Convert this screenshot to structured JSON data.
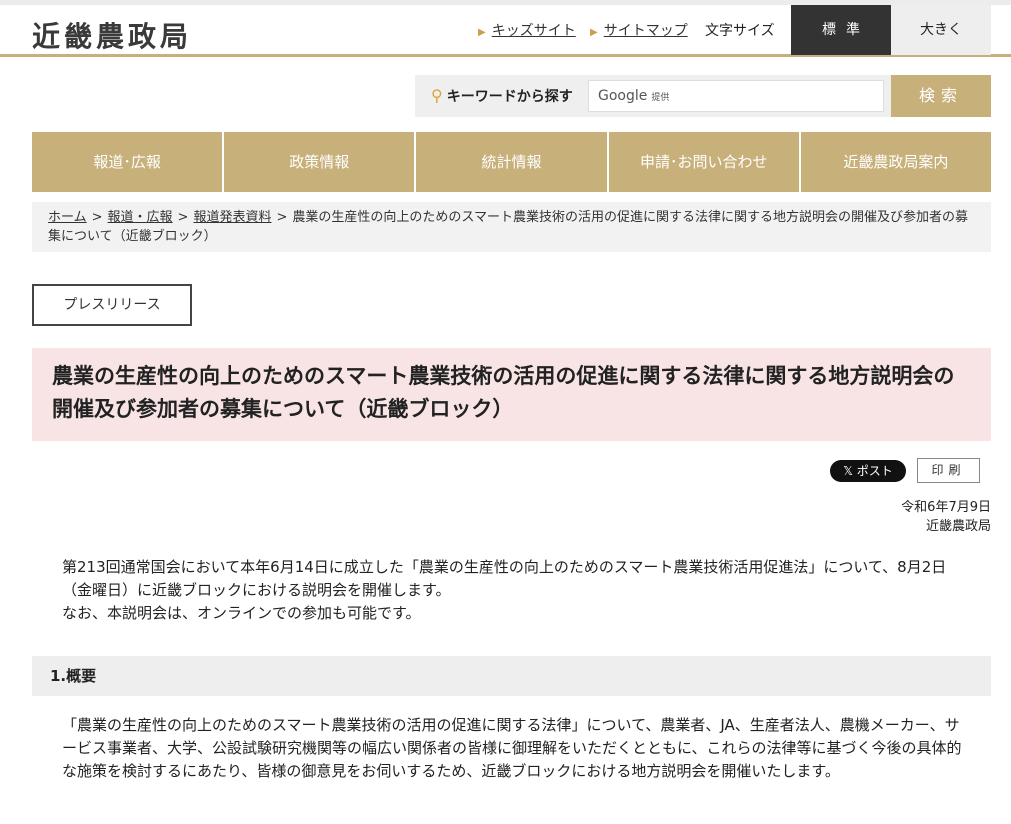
{
  "header": {
    "logo": "近畿農政局",
    "links": [
      "キッズサイト",
      "サイトマップ"
    ],
    "font_size_label": "文字サイズ",
    "font_size_standard": "標準",
    "font_size_large": "大きく"
  },
  "search": {
    "label": "キーワードから探す",
    "placeholder": "Google",
    "provider_suffix": "提供",
    "button": "検索"
  },
  "global_nav": [
    "報道･広報",
    "政策情報",
    "統計情報",
    "申請･お問い合わせ",
    "近畿農政局案内"
  ],
  "breadcrumb": {
    "items": [
      "ホーム",
      "報道・広報",
      "報道発表資料"
    ],
    "current": "農業の生産性の向上のためのスマート農業技術の活用の促進に関する法律に関する地方説明会の開催及び参加者の募集について（近畿ブロック）"
  },
  "press_label": "プレスリリース",
  "title": "農業の生産性の向上のためのスマート農業技術の活用の促進に関する法律に関する地方説明会の開催及び参加者の募集について（近畿ブロック）",
  "share": {
    "post_label": "ポスト",
    "print_label": "印刷"
  },
  "date": "令和6年7月9日",
  "org": "近畿農政局",
  "intro": [
    "第213回通常国会において本年6月14日に成立した「農業の生産性の向上のためのスマート農業技術活用促進法」について、8月2日（金曜日）に近畿ブロックにおける説明会を開催します。",
    "なお、本説明会は、オンラインでの参加も可能です。"
  ],
  "section1": {
    "heading": "1.概要",
    "body": "「農業の生産性の向上のためのスマート農業技術の活用の促進に関する法律」について、農業者、JA、生産者法人、農機メーカー、サービス事業者、大学、公設試験研究機関等の幅広い関係者の皆様に御理解をいただくとともに、これらの法律等に基づく今後の具体的な施策を検討するにあたり、皆様の御意見をお伺いするため、近畿ブロックにおける地方説明会を開催いたします。"
  },
  "colors": {
    "accent": "#c8b07a",
    "title_bg": "#f8e4e4",
    "dark": "#333333"
  }
}
